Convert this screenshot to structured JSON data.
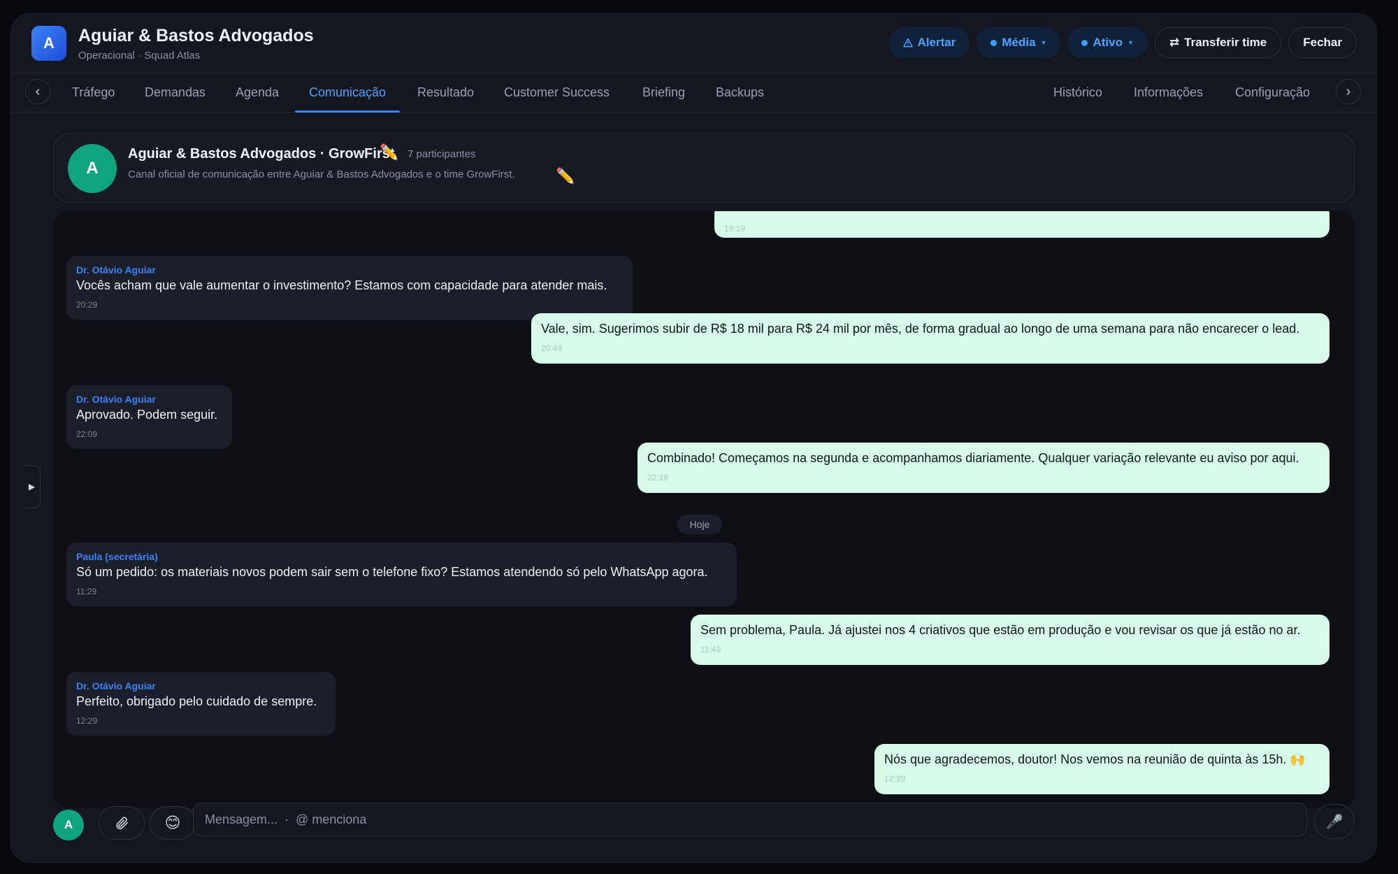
{
  "header": {
    "avatar_letter": "A",
    "title": "Aguiar & Bastos Advogados",
    "subtitle": "Operacional · Squad Atlas",
    "alert_label": "Alertar",
    "priority_label": "Média",
    "status_label": "Ativo",
    "transfer_label": "Transferir time",
    "close_label": "Fechar"
  },
  "tabs": {
    "left": [
      "Tráfego",
      "Demandas",
      "Agenda",
      "Comunicação",
      "Resultado",
      "Customer Success",
      "Briefing",
      "Backups"
    ],
    "right": [
      "Histórico",
      "Informações",
      "Configuração"
    ],
    "active": "Comunicação"
  },
  "channel": {
    "avatar_letter": "A",
    "title": "Aguiar & Bastos Advogados · GrowFirst",
    "participants": "7 participantes",
    "description": "Canal oficial de comunicação entre Aguiar & Bastos Advogados e o time GrowFirst."
  },
  "messages": [
    {
      "direction": "out",
      "author": "",
      "text": "",
      "time": "19:19"
    },
    {
      "direction": "in",
      "author": "Dr. Otávio Aguiar",
      "text": "Vocês acham que vale aumentar o investimento? Estamos com capacidade para atender mais.",
      "time": "20:29"
    },
    {
      "direction": "out",
      "author": "",
      "text": "Vale, sim. Sugerimos subir de R$ 18 mil para R$ 24 mil por mês, de forma gradual ao longo de uma semana para não encarecer o lead.",
      "time": "20:49"
    },
    {
      "direction": "in",
      "author": "Dr. Otávio Aguiar",
      "text": "Aprovado. Podem seguir.",
      "time": "22:09"
    },
    {
      "direction": "out",
      "author": "",
      "text": "Combinado! Começamos na segunda e acompanhamos diariamente. Qualquer variação relevante eu aviso por aqui.",
      "time": "22:19"
    },
    {
      "direction": "in",
      "author": "Paula (secretária)",
      "text": "Só um pedido: os materiais novos podem sair sem o telefone fixo? Estamos atendendo só pelo WhatsApp agora.",
      "time": "11:29"
    },
    {
      "direction": "out",
      "author": "",
      "text": "Sem problema, Paula. Já ajustei nos 4 criativos que estão em produção e vou revisar os que já estão no ar.",
      "time": "11:49"
    },
    {
      "direction": "in",
      "author": "Dr. Otávio Aguiar",
      "text": "Perfeito, obrigado pelo cuidado de sempre.",
      "time": "12:29"
    },
    {
      "direction": "out",
      "author": "",
      "text": "Nós que agradecemos, doutor! Nos vemos na reunião de quinta às 15h. 🙌",
      "time": "12:39"
    }
  ],
  "day_separator": "Hoje",
  "composer": {
    "avatar_letter": "A",
    "placeholder": "Mensagem...  ·  @ menciona",
    "attach_icon": "paperclip-icon",
    "emoji_icon": "emoji-icon",
    "mic_icon": "microphone-icon"
  },
  "colors": {
    "accent": "#3b82f6",
    "outgoing_bubble": "#d7fbe8",
    "incoming_bubble": "#1b1f2a",
    "channel_avatar": "#10a37f"
  }
}
